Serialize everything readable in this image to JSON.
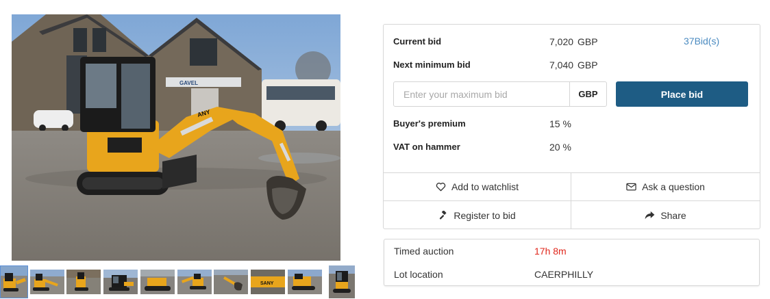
{
  "bid": {
    "current_bid_label": "Current bid",
    "current_bid_amount": "7,020",
    "current_bid_currency": "GBP",
    "bids_count": "37Bid(s)",
    "next_min_label": "Next minimum bid",
    "next_min_amount": "7,040",
    "next_min_currency": "GBP",
    "input_placeholder": "Enter your maximum bid",
    "input_currency": "GBP",
    "place_bid_label": "Place bid",
    "buyers_premium_label": "Buyer's premium",
    "buyers_premium_value": "15 %",
    "vat_label": "VAT on hammer",
    "vat_value": "20 %",
    "accent_color": "#1e5c84"
  },
  "actions": {
    "watchlist": {
      "label": "Add to watchlist",
      "icon": "heart-icon"
    },
    "question": {
      "label": "Ask a question",
      "icon": "envelope-icon"
    },
    "register": {
      "label": "Register to bid",
      "icon": "gavel-icon"
    },
    "share": {
      "label": "Share",
      "icon": "share-icon"
    }
  },
  "info": {
    "timed_auction_label": "Timed auction",
    "timed_auction_value": "17h 8m",
    "lot_location_label": "Lot location",
    "lot_location_value": "CAERPHILLY"
  },
  "gallery": {
    "image_count": 10,
    "selected_index": 0,
    "sign_text": "GAVEL"
  }
}
